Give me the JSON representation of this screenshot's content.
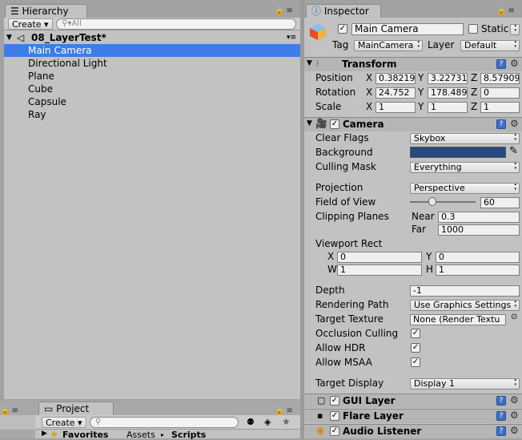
{
  "hierarchy": {
    "tab_label": "Hierarchy",
    "create_label": "Create",
    "search_placeholder": "All",
    "scene_name": "08_LayerTest*",
    "items": [
      "Main Camera",
      "Directional Light",
      "Plane",
      "Cube",
      "Capsule",
      "Ray"
    ]
  },
  "project": {
    "tab_label": "Project",
    "create_label": "Create",
    "favorites_label": "Favorites",
    "breadcrumb": [
      "Assets",
      "Scripts"
    ]
  },
  "inspector": {
    "tab_label": "Inspector",
    "object_name": "Main Camera",
    "static_label": "Static",
    "tag_label": "Tag",
    "tag_value": "MainCamera",
    "layer_label": "Layer",
    "layer_value": "Default",
    "transform": {
      "title": "Transform",
      "position_label": "Position",
      "rotation_label": "Rotation",
      "scale_label": "Scale",
      "position": [
        "0.38219",
        "3.22731",
        "8.57909"
      ],
      "rotation": [
        "24.752",
        "178.489",
        "0"
      ],
      "scale": [
        "1",
        "1",
        "1"
      ],
      "x": "X",
      "y": "Y",
      "z": "Z"
    },
    "camera": {
      "title": "Camera",
      "clear_flags_label": "Clear Flags",
      "clear_flags_value": "Skybox",
      "background_label": "Background",
      "background_color": "#274a7d",
      "culling_mask_label": "Culling Mask",
      "culling_mask_value": "Everything",
      "projection_label": "Projection",
      "projection_value": "Perspective",
      "fov_label": "Field of View",
      "fov_value": "60",
      "fov_slider_fraction": 0.34,
      "clipping_label": "Clipping Planes",
      "near_label": "Near",
      "near_value": "0.3",
      "far_label": "Far",
      "far_value": "1000",
      "viewport_label": "Viewport Rect",
      "vp_x_label": "X",
      "vp_x": "0",
      "vp_y_label": "Y",
      "vp_y": "0",
      "vp_w_label": "W",
      "vp_w": "1",
      "vp_h_label": "H",
      "vp_h": "1",
      "depth_label": "Depth",
      "depth_value": "-1",
      "rendering_path_label": "Rendering Path",
      "rendering_path_value": "Use Graphics Settings",
      "target_texture_label": "Target Texture",
      "target_texture_value": "None (Render Textu",
      "occlusion_label": "Occlusion Culling",
      "hdr_label": "Allow HDR",
      "msaa_label": "Allow MSAA",
      "target_display_label": "Target Display",
      "target_display_value": "Display 1"
    },
    "components": [
      "GUI Layer",
      "Flare Layer",
      "Audio Listener"
    ]
  },
  "colors": {
    "selection": "#3e7de7",
    "panel": "#c2c2c2",
    "help": "#3d6fc6"
  }
}
